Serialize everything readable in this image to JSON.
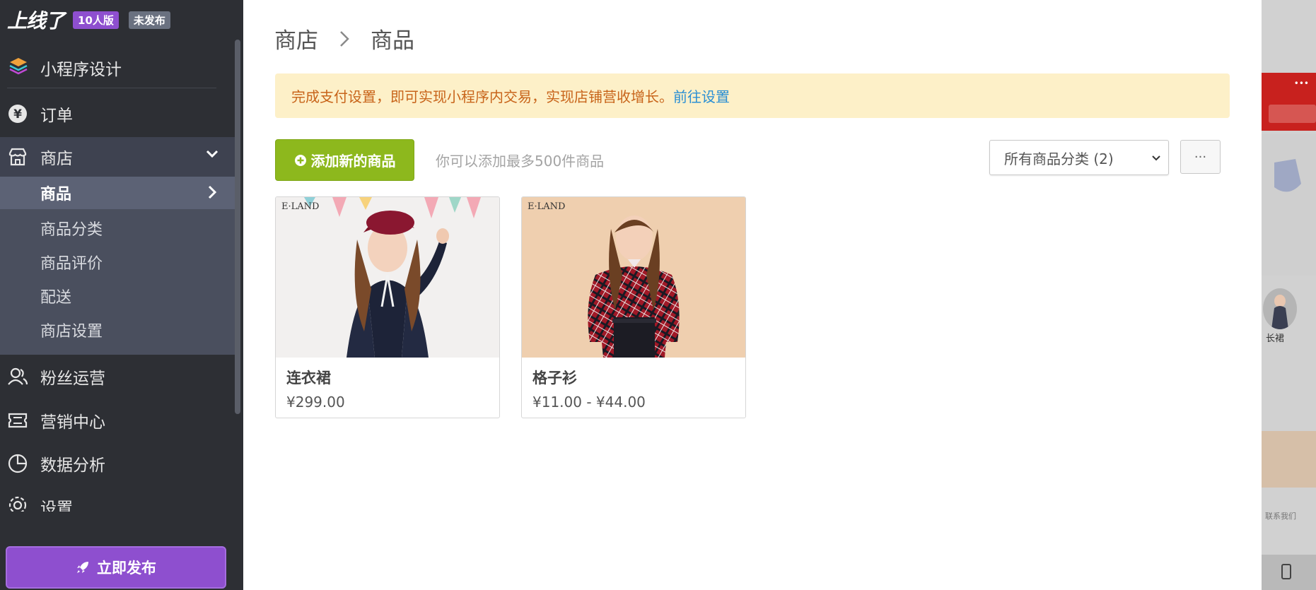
{
  "brand": {
    "logo": "上线了",
    "edition_badge": "10人版",
    "status_badge": "未发布"
  },
  "sidebar": {
    "design": "小程序设计",
    "items": {
      "orders": "订单",
      "shop": "商店",
      "fans": "粉丝运营",
      "marketing": "营销中心",
      "analytics": "数据分析",
      "settings": "设置"
    },
    "shop_sub": [
      "商品",
      "商品分类",
      "商品评价",
      "配送",
      "商店设置"
    ],
    "publish": "立即发布"
  },
  "breadcrumb": {
    "root": "商店",
    "current": "商品"
  },
  "notice": {
    "text": "完成支付设置，即可实现小程序内交易，实现店铺营收增长。",
    "link": "前往设置"
  },
  "toolbar": {
    "add_button": "添加新的商品",
    "limit_text": "你可以添加最多500件商品",
    "category_select": "所有商品分类 (2)",
    "more": "···"
  },
  "products": [
    {
      "name": "连衣裙",
      "price": "¥299.00",
      "brand": "E·LAND"
    },
    {
      "name": "格子衫",
      "price": "¥11.00 - ¥44.00",
      "brand": "E·LAND"
    }
  ],
  "preview": {
    "label_skirt": "长裙",
    "contact": "联系我们"
  },
  "colors": {
    "sidebar_bg": "#2d2f34",
    "accent_purple": "#8e4fcf",
    "add_green": "#8db81d",
    "notice_bg": "#fdf0c8",
    "notice_text": "#c8641a",
    "link_blue": "#2a8fd4"
  }
}
